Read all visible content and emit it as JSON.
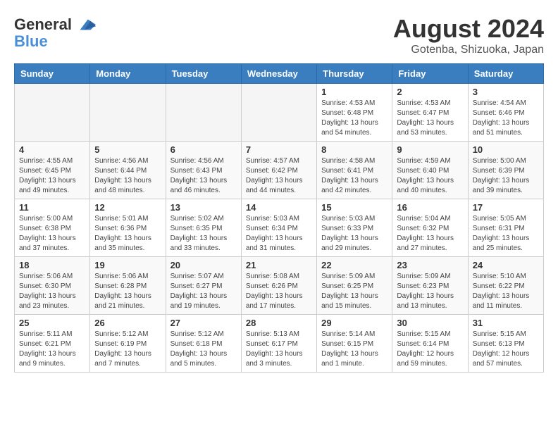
{
  "logo": {
    "line1": "General",
    "line2": "Blue"
  },
  "title": "August 2024",
  "location": "Gotenba, Shizuoka, Japan",
  "weekdays": [
    "Sunday",
    "Monday",
    "Tuesday",
    "Wednesday",
    "Thursday",
    "Friday",
    "Saturday"
  ],
  "weeks": [
    [
      {
        "day": "",
        "info": ""
      },
      {
        "day": "",
        "info": ""
      },
      {
        "day": "",
        "info": ""
      },
      {
        "day": "",
        "info": ""
      },
      {
        "day": "1",
        "info": "Sunrise: 4:53 AM\nSunset: 6:48 PM\nDaylight: 13 hours\nand 54 minutes."
      },
      {
        "day": "2",
        "info": "Sunrise: 4:53 AM\nSunset: 6:47 PM\nDaylight: 13 hours\nand 53 minutes."
      },
      {
        "day": "3",
        "info": "Sunrise: 4:54 AM\nSunset: 6:46 PM\nDaylight: 13 hours\nand 51 minutes."
      }
    ],
    [
      {
        "day": "4",
        "info": "Sunrise: 4:55 AM\nSunset: 6:45 PM\nDaylight: 13 hours\nand 49 minutes."
      },
      {
        "day": "5",
        "info": "Sunrise: 4:56 AM\nSunset: 6:44 PM\nDaylight: 13 hours\nand 48 minutes."
      },
      {
        "day": "6",
        "info": "Sunrise: 4:56 AM\nSunset: 6:43 PM\nDaylight: 13 hours\nand 46 minutes."
      },
      {
        "day": "7",
        "info": "Sunrise: 4:57 AM\nSunset: 6:42 PM\nDaylight: 13 hours\nand 44 minutes."
      },
      {
        "day": "8",
        "info": "Sunrise: 4:58 AM\nSunset: 6:41 PM\nDaylight: 13 hours\nand 42 minutes."
      },
      {
        "day": "9",
        "info": "Sunrise: 4:59 AM\nSunset: 6:40 PM\nDaylight: 13 hours\nand 40 minutes."
      },
      {
        "day": "10",
        "info": "Sunrise: 5:00 AM\nSunset: 6:39 PM\nDaylight: 13 hours\nand 39 minutes."
      }
    ],
    [
      {
        "day": "11",
        "info": "Sunrise: 5:00 AM\nSunset: 6:38 PM\nDaylight: 13 hours\nand 37 minutes."
      },
      {
        "day": "12",
        "info": "Sunrise: 5:01 AM\nSunset: 6:36 PM\nDaylight: 13 hours\nand 35 minutes."
      },
      {
        "day": "13",
        "info": "Sunrise: 5:02 AM\nSunset: 6:35 PM\nDaylight: 13 hours\nand 33 minutes."
      },
      {
        "day": "14",
        "info": "Sunrise: 5:03 AM\nSunset: 6:34 PM\nDaylight: 13 hours\nand 31 minutes."
      },
      {
        "day": "15",
        "info": "Sunrise: 5:03 AM\nSunset: 6:33 PM\nDaylight: 13 hours\nand 29 minutes."
      },
      {
        "day": "16",
        "info": "Sunrise: 5:04 AM\nSunset: 6:32 PM\nDaylight: 13 hours\nand 27 minutes."
      },
      {
        "day": "17",
        "info": "Sunrise: 5:05 AM\nSunset: 6:31 PM\nDaylight: 13 hours\nand 25 minutes."
      }
    ],
    [
      {
        "day": "18",
        "info": "Sunrise: 5:06 AM\nSunset: 6:30 PM\nDaylight: 13 hours\nand 23 minutes."
      },
      {
        "day": "19",
        "info": "Sunrise: 5:06 AM\nSunset: 6:28 PM\nDaylight: 13 hours\nand 21 minutes."
      },
      {
        "day": "20",
        "info": "Sunrise: 5:07 AM\nSunset: 6:27 PM\nDaylight: 13 hours\nand 19 minutes."
      },
      {
        "day": "21",
        "info": "Sunrise: 5:08 AM\nSunset: 6:26 PM\nDaylight: 13 hours\nand 17 minutes."
      },
      {
        "day": "22",
        "info": "Sunrise: 5:09 AM\nSunset: 6:25 PM\nDaylight: 13 hours\nand 15 minutes."
      },
      {
        "day": "23",
        "info": "Sunrise: 5:09 AM\nSunset: 6:23 PM\nDaylight: 13 hours\nand 13 minutes."
      },
      {
        "day": "24",
        "info": "Sunrise: 5:10 AM\nSunset: 6:22 PM\nDaylight: 13 hours\nand 11 minutes."
      }
    ],
    [
      {
        "day": "25",
        "info": "Sunrise: 5:11 AM\nSunset: 6:21 PM\nDaylight: 13 hours\nand 9 minutes."
      },
      {
        "day": "26",
        "info": "Sunrise: 5:12 AM\nSunset: 6:19 PM\nDaylight: 13 hours\nand 7 minutes."
      },
      {
        "day": "27",
        "info": "Sunrise: 5:12 AM\nSunset: 6:18 PM\nDaylight: 13 hours\nand 5 minutes."
      },
      {
        "day": "28",
        "info": "Sunrise: 5:13 AM\nSunset: 6:17 PM\nDaylight: 13 hours\nand 3 minutes."
      },
      {
        "day": "29",
        "info": "Sunrise: 5:14 AM\nSunset: 6:15 PM\nDaylight: 13 hours\nand 1 minute."
      },
      {
        "day": "30",
        "info": "Sunrise: 5:15 AM\nSunset: 6:14 PM\nDaylight: 12 hours\nand 59 minutes."
      },
      {
        "day": "31",
        "info": "Sunrise: 5:15 AM\nSunset: 6:13 PM\nDaylight: 12 hours\nand 57 minutes."
      }
    ]
  ]
}
